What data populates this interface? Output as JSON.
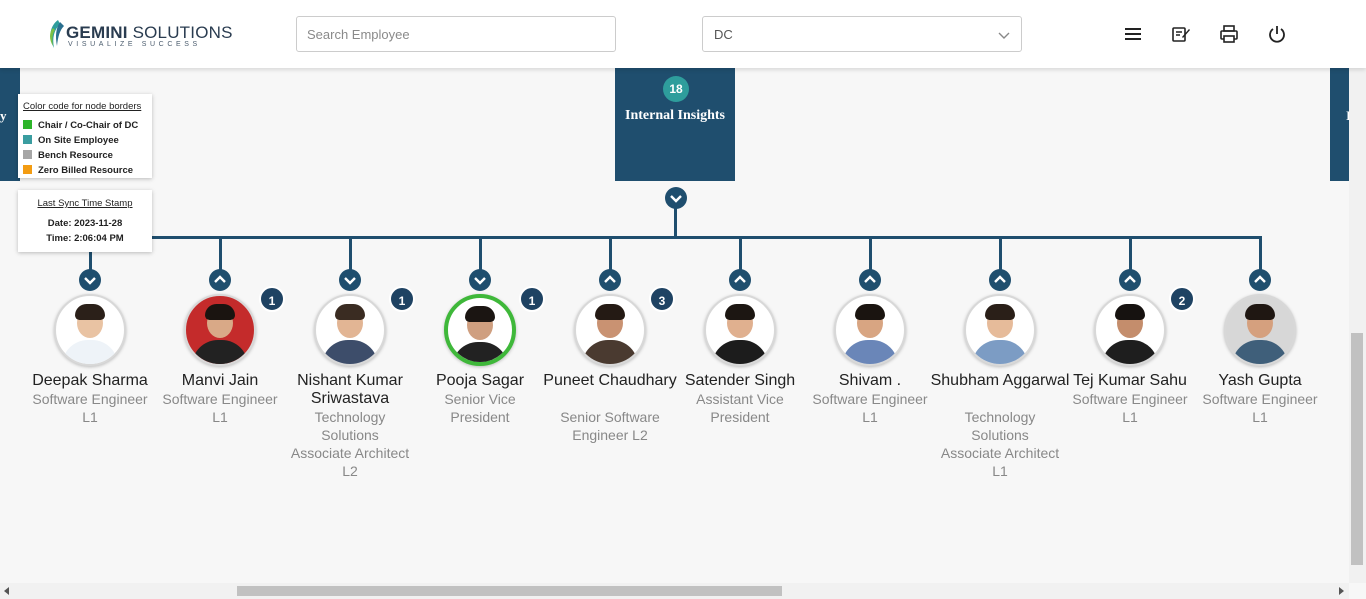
{
  "header": {
    "logo_name": "GEMINI",
    "logo_name_suffix": "SOLUTIONS",
    "logo_tagline": "VISUALIZE SUCCESS",
    "search_placeholder": "Search Employee",
    "dept_select_value": "DC",
    "icons": [
      "menu-icon",
      "edit-note-icon",
      "print-icon",
      "power-icon"
    ]
  },
  "legend": {
    "title": "Color code for node borders",
    "items": [
      {
        "label": "Chair / Co-Chair of DC",
        "color": "#2db52a"
      },
      {
        "label": "On Site Employee",
        "color": "#3a9da0"
      },
      {
        "label": "Bench Resource",
        "color": "#a6a6a6"
      },
      {
        "label": "Zero Billed Resource",
        "color": "#f39c12"
      }
    ]
  },
  "sync": {
    "title": "Last Sync Time Stamp",
    "date": "Date: 2023-11-28",
    "time": "Time: 2:06:04 PM"
  },
  "department": {
    "count": "18",
    "title": "Internal Insights"
  },
  "side_nodes": {
    "left_text": "y",
    "right_text": "I"
  },
  "employees": [
    {
      "name": "Deepak Sharma",
      "role": [
        "Software Engineer",
        "L1"
      ],
      "badge": "",
      "toggle": "down",
      "border": "#d8d8d8"
    },
    {
      "name": "Manvi Jain",
      "role": [
        "Software Engineer",
        "L1"
      ],
      "badge": "1",
      "toggle": "up",
      "border": "#d8d8d8"
    },
    {
      "name": "Nishant Kumar Sriwastava",
      "role": [
        "Technology",
        "Solutions",
        "Associate Architect",
        "L2"
      ],
      "badge": "1",
      "toggle": "down",
      "border": "#d8d8d8"
    },
    {
      "name": "Pooja Sagar",
      "role": [
        "Senior Vice",
        "President"
      ],
      "badge": "1",
      "toggle": "down",
      "border": "#3fb83a"
    },
    {
      "name": "Puneet Chaudhary",
      "role": [
        "Senior Software",
        "Engineer L2"
      ],
      "badge": "3",
      "toggle": "up",
      "border": "#d8d8d8"
    },
    {
      "name": "Satender Singh",
      "role": [
        "Assistant Vice",
        "President"
      ],
      "badge": "",
      "toggle": "up",
      "border": "#d8d8d8"
    },
    {
      "name": "Shivam .",
      "role": [
        "Software Engineer",
        "L1"
      ],
      "badge": "",
      "toggle": "up",
      "border": "#d8d8d8"
    },
    {
      "name": "Shubham Aggarwal",
      "role": [
        "Technology",
        "Solutions",
        "Associate Architect",
        "L1"
      ],
      "badge": "",
      "toggle": "up",
      "border": "#d8d8d8"
    },
    {
      "name": "Tej Kumar Sahu",
      "role": [
        "Software Engineer",
        "L1"
      ],
      "badge": "2",
      "toggle": "up",
      "border": "#d8d8d8"
    },
    {
      "name": "Yash Gupta",
      "role": [
        "Software Engineer",
        "L1"
      ],
      "badge": "",
      "toggle": "up",
      "border": "#d8d8d8"
    }
  ],
  "colors": {
    "node": "#1f4e6e",
    "accent_teal": "#2e9d9c",
    "badge": "#1f4363"
  }
}
